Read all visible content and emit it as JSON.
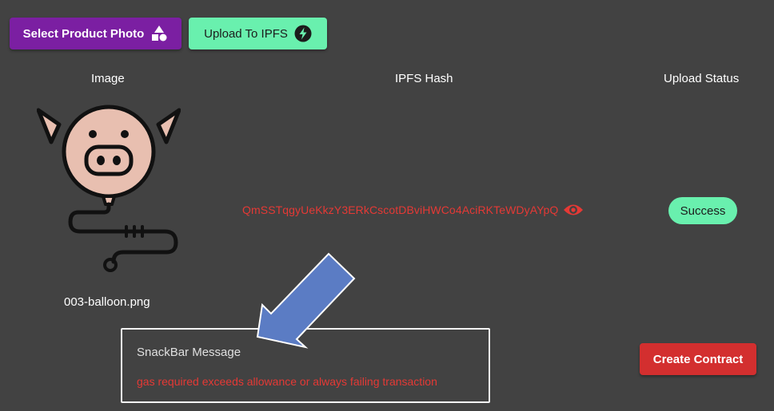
{
  "toolbar": {
    "select_label": "Select Product Photo",
    "select_icon": "shapes-icon",
    "upload_label": "Upload To IPFS",
    "upload_icon": "bolt-icon"
  },
  "table": {
    "headers": [
      "Image",
      "IPFS Hash",
      "Upload Status"
    ],
    "row": {
      "filename": "003-balloon.png",
      "image_icon": "pig-balloon-icon",
      "hash": "QmSSTqgyUeKkzY3ERkCscotDBviHWCo4AciRKTeWDyAYpQ",
      "hash_icon": "eye-icon",
      "status": "Success"
    }
  },
  "snackbar": {
    "title": "SnackBar Message",
    "message": "gas required exceeds allowance or always failing transaction"
  },
  "actions": {
    "create_contract_label": "Create Contract"
  },
  "colors": {
    "background": "#424242",
    "purple": "#7b1fa2",
    "green": "#69f0ae",
    "red": "#d32f2f",
    "error_text": "#e53935",
    "arrow": "#5b7cc4"
  }
}
